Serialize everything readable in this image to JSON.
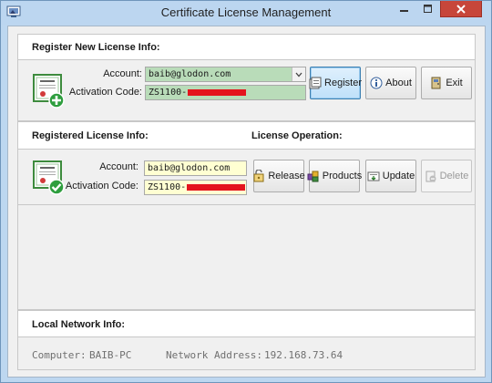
{
  "window": {
    "title": "Certificate License Management"
  },
  "register_section": {
    "heading": "Register New License Info:",
    "account_label": "Account:",
    "account_value": "baib@glodon.com",
    "code_label": "Activation Code:",
    "code_value": "ZS1100-",
    "buttons": {
      "register": "Register",
      "about": "About",
      "exit": "Exit"
    }
  },
  "registered_section": {
    "heading": "Registered License Info:",
    "operation_heading": "License Operation:",
    "account_label": "Account:",
    "account_value": "baib@glodon.com",
    "code_label": "Activation Code:",
    "code_value": "ZS1100-",
    "buttons": {
      "release": "Release",
      "products": "Products",
      "update": "Update",
      "delete": "Delete"
    }
  },
  "network_section": {
    "heading": "Local Network Info:",
    "computer_label": "Computer:",
    "computer_value": "BAIB-PC",
    "address_label": "Network Address:",
    "address_value": "192.168.73.64"
  },
  "colors": {
    "registered_field": "#ffffd2",
    "input_field": "#b9dcb9",
    "redaction": "#e4141d",
    "close_button": "#c7463a"
  }
}
